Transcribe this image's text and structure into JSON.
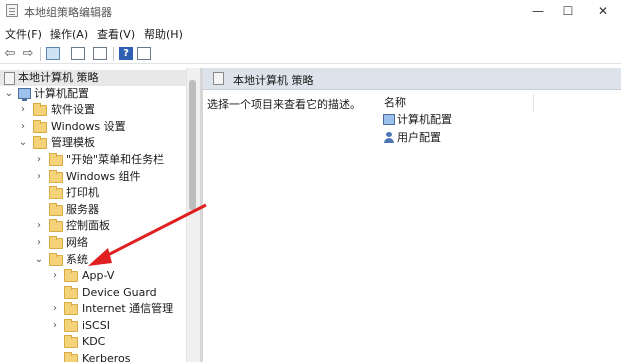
{
  "window": {
    "title": "本地组策略编辑器",
    "min_glyph": "—",
    "max_glyph": "☐",
    "close_glyph": "✕"
  },
  "menu": [
    "文件(F)",
    "操作(A)",
    "查看(V)",
    "帮助(H)"
  ],
  "toolbar": {
    "back_glyph": "⇦",
    "forward_glyph": "⇨",
    "help_glyph": "?"
  },
  "tree": {
    "root": "本地计算机 策略",
    "computer_config": "计算机配置",
    "software_settings": "软件设置",
    "windows_settings": "Windows 设置",
    "admin_templates": "管理模板",
    "start_menu": "\"开始\"菜单和任务栏",
    "windows_components": "Windows 组件",
    "printers": "打印机",
    "server": "服务器",
    "control_panel": "控制面板",
    "network": "网络",
    "system": "系统",
    "app_v": "App-V",
    "device_guard": "Device Guard",
    "internet_comm": "Internet 通信管理",
    "iscsi": "iSCSI",
    "kdc": "KDC",
    "kerberos": "Kerberos"
  },
  "right_pane": {
    "header": "本地计算机 策略",
    "description": "选择一个项目来查看它的描述。",
    "column_name": "名称",
    "items": [
      "计算机配置",
      "用户配置"
    ]
  },
  "icons": {
    "folder": "folder-icon",
    "computer": "computer-icon",
    "user": "user-icon",
    "policy": "policy-icon"
  },
  "colors": {
    "folder_fill": "#f3d27a",
    "annotation_arrow": "#e02020",
    "header_bg": "#dde3eb"
  }
}
